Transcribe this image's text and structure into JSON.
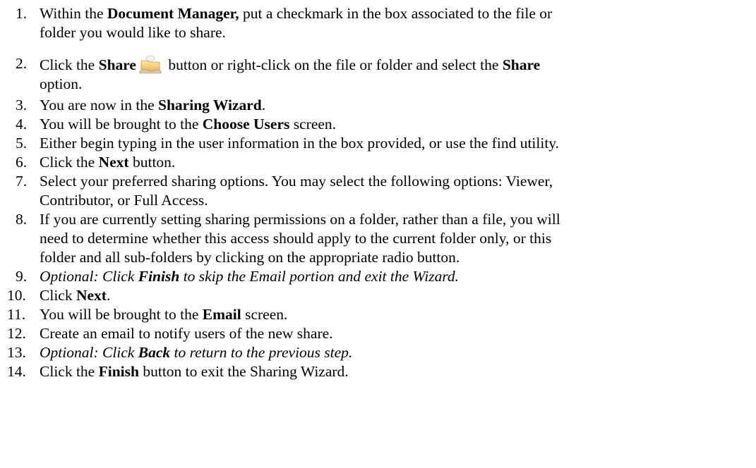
{
  "steps": [
    {
      "num": "1.",
      "l1a": "Within the ",
      "l1b": "Document Manager,",
      "l1c": " put a checkmark in the box associated to the file or",
      "l2": "folder you would like to share."
    },
    {
      "num": "2.",
      "l1a": "Click the ",
      "l1b": "Share",
      "l1c": " button or right-click on the file or folder and select the ",
      "l1d": "Share",
      "l2": "option.",
      "icon": "share-folder-icon"
    },
    {
      "num": "3.",
      "a": "You are now in the ",
      "b": "Sharing Wizard",
      "c": "."
    },
    {
      "num": "4.",
      "a": "You will be brought to the ",
      "b": "Choose Users",
      "c": " screen."
    },
    {
      "num": "5.",
      "a": "Either begin typing in the user information in the box provided, or use the find utility."
    },
    {
      "num": "6.",
      "a": "Click the ",
      "b": "Next",
      "c": " button."
    },
    {
      "num": "7.",
      "l1": "Select your preferred sharing options. You may select the following options: Viewer,",
      "l2": "Contributor, or Full Access."
    },
    {
      "num": "8.",
      "l1": "If you are currently setting sharing permissions on a folder, rather than a file, you will",
      "l2": "need to determine whether this access should apply to the current folder only, or this",
      "l3": "folder and all sub-folders by clicking on the appropriate radio button."
    },
    {
      "num": "9.",
      "a": "Optional: Click ",
      "b": "Finish",
      "c": " to skip the Email portion and exit the Wizard."
    },
    {
      "num": "10.",
      "a": "Click ",
      "b": "Next",
      "c": "."
    },
    {
      "num": "11.",
      "a": "You will be brought to the ",
      "b": "Email",
      "c": " screen."
    },
    {
      "num": "12.",
      "a": "Create an email to notify users of the new share."
    },
    {
      "num": "13.",
      "a": "Optional: Click ",
      "b": "Back",
      "c": " to return to the previous step."
    },
    {
      "num": "14.",
      "a": "Click the ",
      "b": "Finish",
      "c": " button to exit the Sharing Wizard."
    }
  ]
}
